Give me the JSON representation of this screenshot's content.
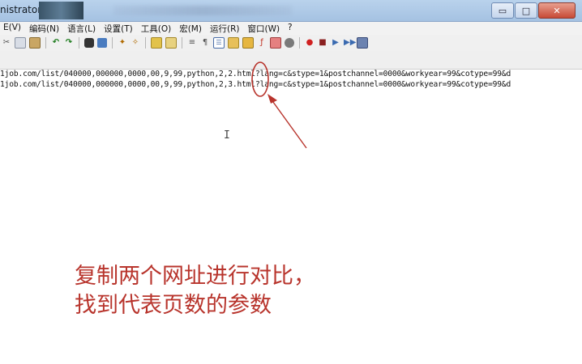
{
  "window": {
    "title_fragment": "nistrator]",
    "buttons": {
      "minimize": "▭",
      "maximize": "□",
      "close": "✕"
    }
  },
  "menu": {
    "items": [
      "E(V)",
      "编码(N)",
      "语言(L)",
      "设置(T)",
      "工具(O)",
      "宏(M)",
      "运行(R)",
      "窗口(W)",
      "?"
    ]
  },
  "toolbar": {
    "icons": [
      "cut-icon",
      "copy-icon",
      "paste-icon",
      "undo-icon",
      "redo-icon",
      "find-icon",
      "replace-icon",
      "zoom-in-icon",
      "zoom-out-icon",
      "sync-icon",
      "wrap-icon",
      "show-all-icon",
      "indent-guide-icon",
      "doc-map-icon",
      "function-list-icon",
      "folder-icon",
      "monitor-icon",
      "record-icon",
      "stop-icon",
      "play-icon",
      "play-multi-icon",
      "save-macro-icon"
    ]
  },
  "editor": {
    "lines": [
      "1job.com/list/040000,000000,0000,00,9,99,python,2,2.html?lang=c&stype=1&postchannel=0000&workyear=99&cotype=99&d",
      "1job.com/list/040000,000000,0000,00,9,99,python,2,3.html?lang=c&stype=1&postchannel=0000&workyear=99&cotype=99&d"
    ]
  },
  "annotation": {
    "line1": "复制两个网址进行对比，",
    "line2": "找到代表页数的参数",
    "color": "#b8342c"
  }
}
